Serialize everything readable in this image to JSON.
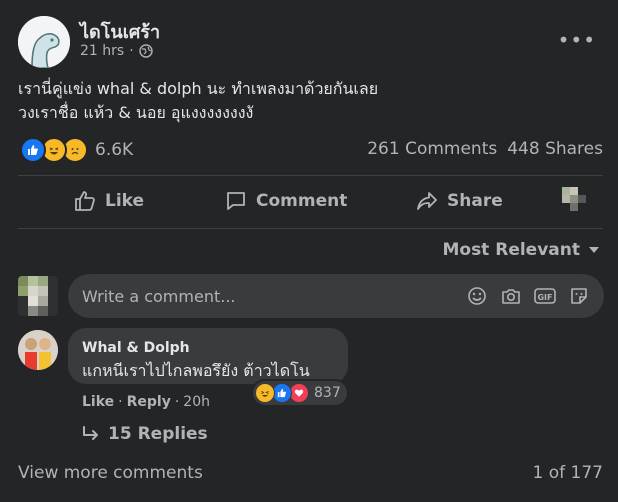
{
  "post": {
    "page_name": "ไดโนเศร้า",
    "time": "21 hrs",
    "audience_icon": "globe-icon",
    "text_line1": "เรานี่คู่แข่ง whal & dolph นะ ทำเพลงมาด้วยกันเลย",
    "text_line2": "วงเราชื่อ แห้ว & นอย อุแงงงงงงงงั",
    "reaction_count": "6.6K",
    "comments_count": "261 Comments",
    "shares_count": "448 Shares"
  },
  "actions": {
    "like": "Like",
    "comment": "Comment",
    "share": "Share"
  },
  "sort": {
    "label": "Most Relevant"
  },
  "composer": {
    "placeholder": "Write a comment..."
  },
  "comment": {
    "author": "Whal & Dolph",
    "text": "แกหนีเราไปไกลพอรึยัง ต้าวไดโน",
    "reaction_count": "837",
    "like": "Like",
    "reply": "Reply",
    "time": "20h",
    "replies": "15 Replies"
  },
  "footer": {
    "view_more": "View more comments",
    "page_count": "1 of 177"
  },
  "colors": {
    "background": "#242526",
    "surface": "#3a3b3c",
    "text_primary": "#e4e6eb",
    "text_secondary": "#b0b3b8",
    "like_blue": "#1877f2",
    "haha_yellow": "#f7b928",
    "love_red": "#f33e58"
  }
}
